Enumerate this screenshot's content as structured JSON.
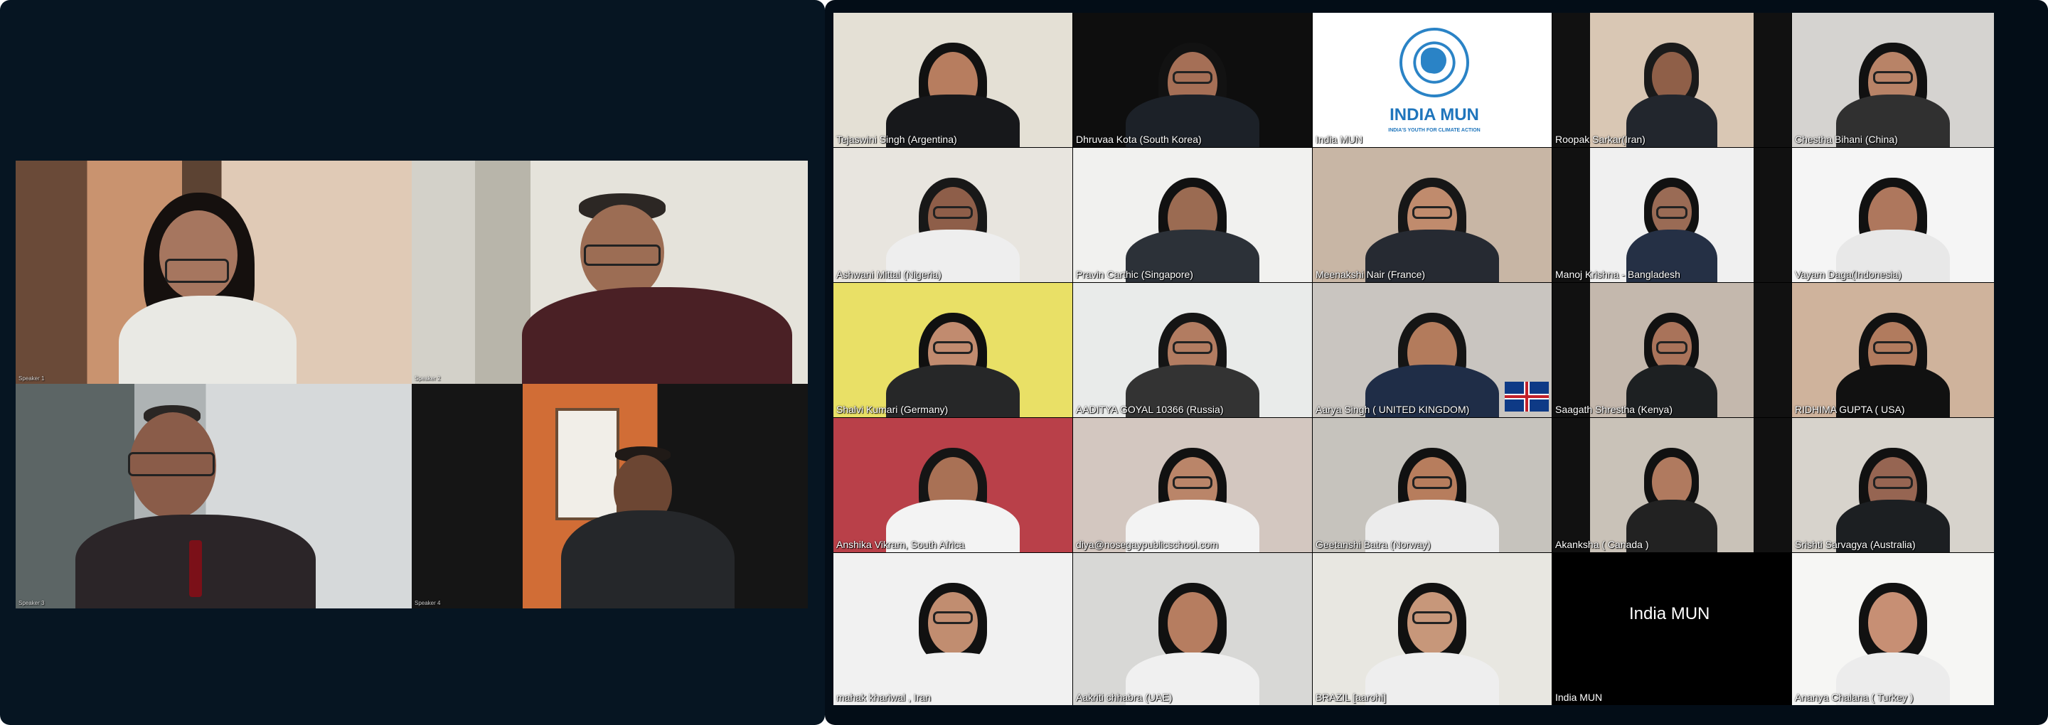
{
  "meeting": {
    "speakers": [
      {
        "label": "Speaker 1"
      },
      {
        "label": "Speaker 2"
      },
      {
        "label": "Speaker 3"
      },
      {
        "label": "Speaker 4"
      }
    ],
    "participants": [
      {
        "label": "Tejaswini Singh (Argentina)"
      },
      {
        "label": "Dhruvaa Kota (South Korea)"
      },
      {
        "label": "India MUN"
      },
      {
        "label": "Roopak Sarkar(Iran)"
      },
      {
        "label": "Chestha Bihani (China)"
      },
      {
        "label": "Ashwani Mittal (Nigeria)"
      },
      {
        "label": "Pravin Carthic (Singapore)"
      },
      {
        "label": "Meenakshi Nair (France)"
      },
      {
        "label": "Manoj Krishna - Bangladesh"
      },
      {
        "label": "Vayam Daga(Indonesia)"
      },
      {
        "label": "Shalvi Kumari (Germany)"
      },
      {
        "label": "AADITYA GOYAL 10366 (Russia)"
      },
      {
        "label": "Aarya Singh ( UNITED KINGDOM)"
      },
      {
        "label": "Saagath Shrestha (Kenya)"
      },
      {
        "label": "RIDHIMA GUPTA ( USA)"
      },
      {
        "label": "Anshika Vikram, South Africa"
      },
      {
        "label": "diya@nosegaypublicschool.com"
      },
      {
        "label": "Geetanshi Batra (Norway)"
      },
      {
        "label": "Akanksha ( Canada )"
      },
      {
        "label": "Srishti Sarvagya (Australia)"
      },
      {
        "label": "mahak khariwal , Iran"
      },
      {
        "label": "Aakriti chhabra (UAE)"
      },
      {
        "label": "BRAZIL [aarohi]"
      },
      {
        "label": "India MUN",
        "center_label": "India MUN"
      },
      {
        "label": "Ananya Chalana ( Turkey )"
      }
    ],
    "logo": {
      "title": "INDIA MUN",
      "subtitle": "INDIA'S YOUTH FOR CLIMATE ACTION",
      "icon": "un-emblem-icon"
    },
    "colors": {
      "left_background": "#061522",
      "right_background": "#030d17",
      "label_text": "#ffffff",
      "logo_blue": "#1f75bc"
    }
  }
}
